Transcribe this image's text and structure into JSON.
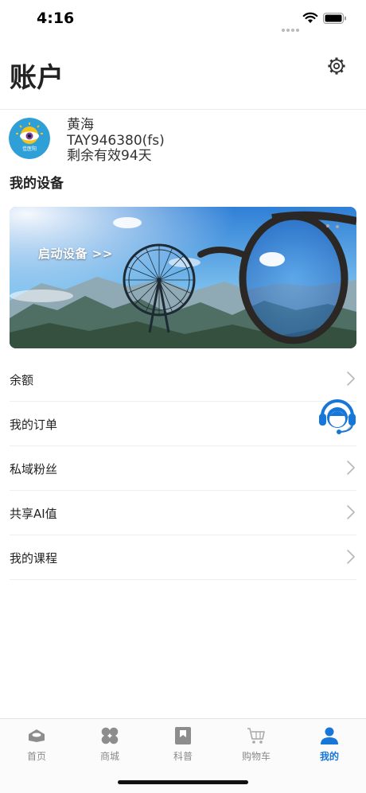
{
  "status_bar": {
    "time": "4:16"
  },
  "header": {
    "title": "账户"
  },
  "user": {
    "name": "黄海",
    "account_id": "TAY946380(fs)",
    "remaining": "剩余有效94天",
    "avatar_text": "佳医阳"
  },
  "devices": {
    "section_title": "我的设备",
    "banner_cta": "启动设备 >>"
  },
  "menu": {
    "items": [
      {
        "label": "余额"
      },
      {
        "label": "我的订单"
      },
      {
        "label": "私域粉丝"
      },
      {
        "label": "共享AI值"
      },
      {
        "label": "我的课程"
      }
    ]
  },
  "tabbar": {
    "tabs": [
      {
        "label": "首页",
        "icon": "home-icon"
      },
      {
        "label": "商城",
        "icon": "grid-icon"
      },
      {
        "label": "科普",
        "icon": "bookmark-icon"
      },
      {
        "label": "购物车",
        "icon": "cart-icon"
      },
      {
        "label": "我的",
        "icon": "person-icon",
        "active": true
      }
    ]
  },
  "colors": {
    "accent": "#1677d8",
    "inactive": "#8a8a8a"
  }
}
